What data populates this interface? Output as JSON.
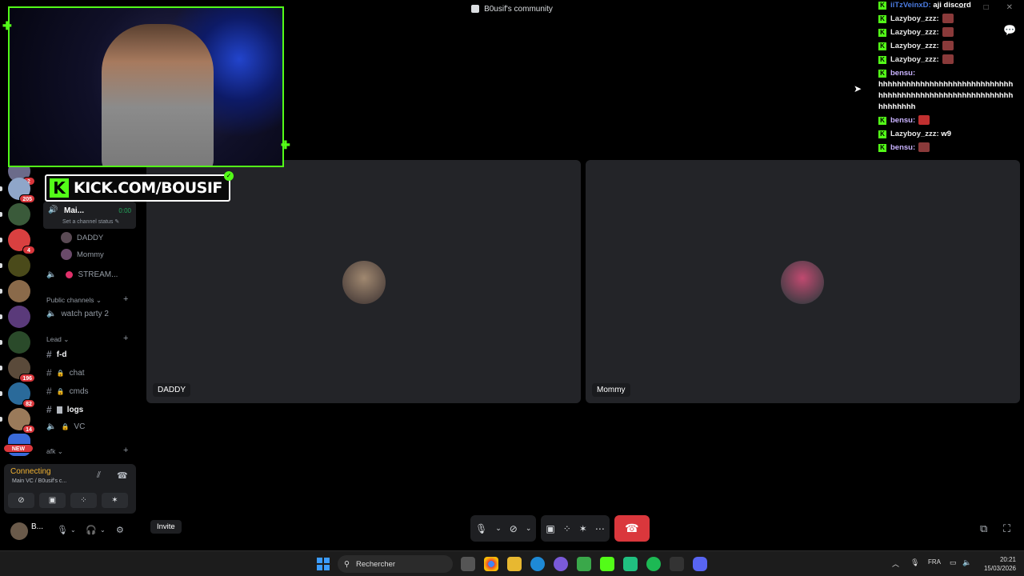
{
  "window": {
    "title": "B0usif's community",
    "controls": [
      "—",
      "□",
      "✕"
    ]
  },
  "guilds": [
    {
      "name": "guild-1",
      "badge": "2",
      "color": "#6b6b8a"
    },
    {
      "name": "guild-2",
      "badge": "205",
      "color": "#8fa6c9"
    },
    {
      "name": "guild-3",
      "badge": "",
      "color": "#3a5a3a"
    },
    {
      "name": "guild-4",
      "badge": "4",
      "color": "#d94040"
    },
    {
      "name": "guild-5",
      "badge": "",
      "color": "#4a4a1a"
    },
    {
      "name": "guild-6",
      "badge": "",
      "color": "#8a6a4a"
    },
    {
      "name": "guild-7",
      "badge": "",
      "color": "#5a3a7a"
    },
    {
      "name": "guild-8",
      "badge": "",
      "color": "#2a4a2a"
    },
    {
      "name": "guild-9",
      "badge": "196",
      "color": "#5a4a3a"
    },
    {
      "name": "guild-10",
      "badge": "82",
      "color": "#2a6a9a"
    },
    {
      "name": "guild-11",
      "badge": "14",
      "color": "#9a7a5a"
    },
    {
      "name": "guild-12",
      "badge": "NEW",
      "color": "#3a6ad9"
    }
  ],
  "channels": {
    "main_vc": {
      "name": "Mai...",
      "time": "0:00",
      "status": "Set a channel status ✎"
    },
    "members": [
      "DADDY",
      "Mommy"
    ],
    "stream_channel": "STREAM...",
    "public_category": "Public channels ⌄",
    "watch_party": "watch party 2",
    "lead_category": "Lead ⌄",
    "text_channels": [
      {
        "name": "f-d",
        "bold": true,
        "locked": false
      },
      {
        "name": "chat",
        "bold": false,
        "locked": true
      },
      {
        "name": "cmds",
        "bold": false,
        "locked": true
      },
      {
        "name": "logs",
        "bold": true,
        "locked": false
      },
      {
        "name": "VC",
        "bold": false,
        "locked": true
      }
    ],
    "afk_category": "afk ⌄"
  },
  "voice_panel": {
    "state": "Connecting",
    "location": "Main VC / B0usif's c..."
  },
  "user_panel": {
    "name": "B..."
  },
  "tiles": [
    {
      "label": "DADDY",
      "avatar_color": "#7a6a5a"
    },
    {
      "label": "Mommy",
      "avatar_color": "#3a5a5a"
    }
  ],
  "call": {
    "invite": "Invite"
  },
  "taskbar": {
    "search_placeholder": "Rechercher",
    "lang": "FRA",
    "time": "20:21",
    "date": "15/03/2026"
  },
  "overlay": {
    "kick_url": "KICK.COM/BOUSIF",
    "kick_letter": "K"
  },
  "chat": [
    {
      "user": "iiTzVeinxD:",
      "text": "aji discord",
      "emote": false
    },
    {
      "user": "Lazyboy_zzz:",
      "text": "",
      "emote": true
    },
    {
      "user": "Lazyboy_zzz:",
      "text": "",
      "emote": true
    },
    {
      "user": "Lazyboy_zzz:",
      "text": "",
      "emote": true
    },
    {
      "user": "Lazyboy_zzz:",
      "text": "",
      "emote": true
    },
    {
      "user": "bensu:",
      "text": "hhhhhhhhhhhhhhhhhhhhhhhhhhhhhhhhhhhhhhhhhhhhhhhhhhhhhhhhhhhhhhhhhh",
      "emote": false
    },
    {
      "user": "bensu:",
      "text": "",
      "emote": true
    },
    {
      "user": "Lazyboy_zzz:",
      "text": "w9",
      "emote": false
    },
    {
      "user": "bensu:",
      "text": "",
      "emote": true
    }
  ]
}
